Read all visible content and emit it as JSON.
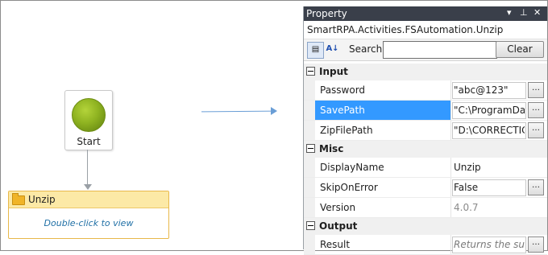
{
  "canvas": {
    "start_label": "Start",
    "activity": {
      "title": "Unzip",
      "hint": "Double-click to view"
    }
  },
  "panel": {
    "title": "Property",
    "activity_type": "SmartRPA.Activities.FSAutomation.Unzip",
    "search_label": "Search:",
    "search_value": "",
    "clear_label": "Clear",
    "categories": [
      {
        "label": "Input",
        "rows": [
          {
            "name": "Password",
            "value": "\"abc@123\""
          },
          {
            "name": "SavePath",
            "value": "\"C:\\ProgramDa"
          },
          {
            "name": "ZipFilePath",
            "value": "\"D:\\CORRECTIC"
          }
        ]
      },
      {
        "label": "Misc",
        "rows": [
          {
            "name": "DisplayName",
            "value": "Unzip"
          },
          {
            "name": "SkipOnError",
            "value": "False"
          },
          {
            "name": "Version",
            "value": "4.0.7"
          }
        ]
      },
      {
        "label": "Output",
        "rows": [
          {
            "name": "Result",
            "value": "Returns the succ"
          }
        ]
      }
    ]
  },
  "icons": {
    "ellipsis": "…",
    "dropdown": "▾",
    "pin": "⊥",
    "close": "✕"
  }
}
